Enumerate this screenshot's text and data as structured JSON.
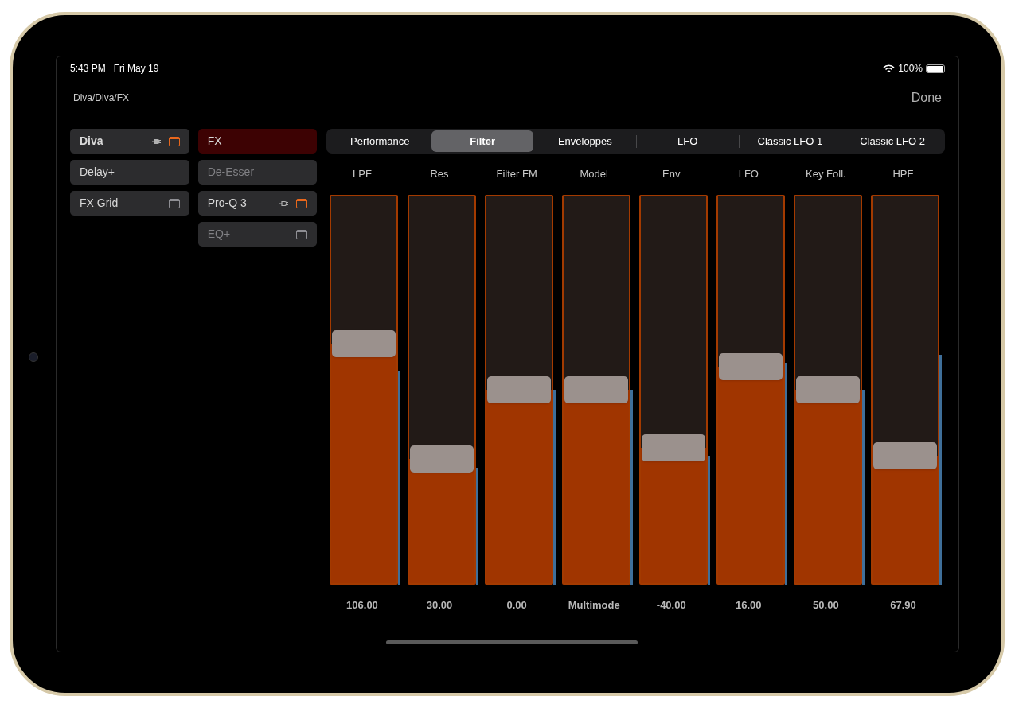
{
  "status_bar": {
    "time": "5:43 PM",
    "date": "Fri May 19",
    "battery": "100%"
  },
  "header": {
    "path": "Diva/Diva/FX",
    "done": "Done"
  },
  "chain": [
    {
      "label": "Diva",
      "bold": true,
      "plug_on": true,
      "window_open": true
    },
    {
      "label": "Delay+",
      "bold": false
    },
    {
      "label": "FX Grid",
      "bold": false,
      "window_open": false
    }
  ],
  "effects": [
    {
      "label": "FX",
      "selected": true,
      "disabled": false
    },
    {
      "label": "De-Esser",
      "selected": false,
      "disabled": true
    },
    {
      "label": "Pro-Q 3",
      "selected": false,
      "disabled": false,
      "plug_on": false,
      "window_open": true
    },
    {
      "label": "EQ+",
      "selected": false,
      "disabled": true,
      "window_open": false
    }
  ],
  "tabs": [
    {
      "label": "Performance",
      "selected": false
    },
    {
      "label": "Filter",
      "selected": true
    },
    {
      "label": "Enveloppes",
      "selected": false
    },
    {
      "label": "LFO",
      "selected": false
    },
    {
      "label": "Classic LFO 1",
      "selected": false
    },
    {
      "label": "Classic LFO 2",
      "selected": false
    }
  ],
  "faders": [
    {
      "label": "LPF",
      "level": 0.62,
      "meter": {
        "level": 0.55
      },
      "value": "106.00"
    },
    {
      "label": "Res",
      "level": 0.32,
      "meter": {
        "level": 0.3
      },
      "value": "30.00"
    },
    {
      "label": "Filter FM",
      "level": 0.5,
      "meter": {
        "level": 0.5
      },
      "value": "0.00"
    },
    {
      "label": "Model",
      "level": 0.5,
      "meter": {
        "level": 0.5
      },
      "value": "Multimode"
    },
    {
      "label": "Env",
      "level": 0.35,
      "meter": {
        "level": 0.33
      },
      "value": "-40.00"
    },
    {
      "label": "LFO",
      "level": 0.56,
      "meter": {
        "level": 0.57
      },
      "value": "16.00"
    },
    {
      "label": "Key Foll.",
      "level": 0.5,
      "meter": {
        "level": 0.5
      },
      "value": "50.00"
    },
    {
      "label": "HPF",
      "level": 0.33,
      "meter": {
        "level": 0.59
      },
      "value": "67.90"
    }
  ]
}
